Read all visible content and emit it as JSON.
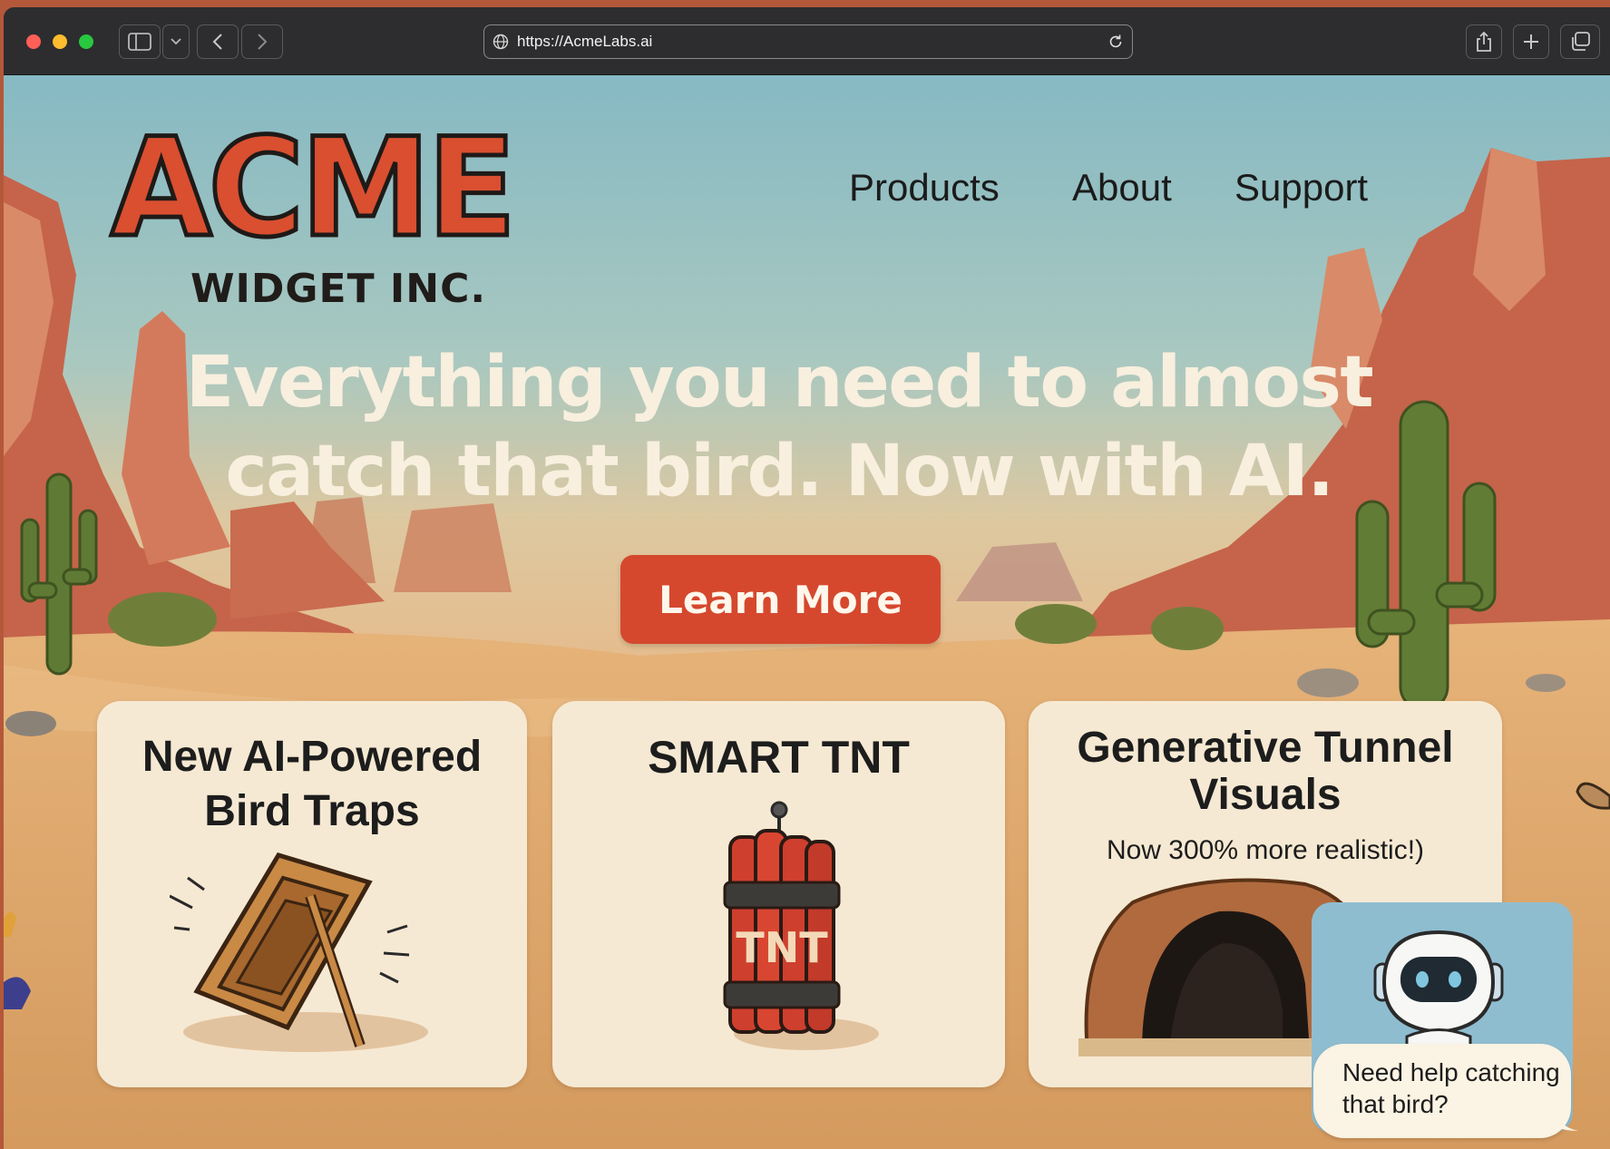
{
  "browser": {
    "url": "https://AcmeLabs.ai"
  },
  "logo": {
    "name": "ACME",
    "subtitle": "WIDGET INC."
  },
  "nav": {
    "products": "Products",
    "about": "About",
    "support": "Support"
  },
  "hero": {
    "headline": "Everything you need to almost catch that bird. Now with AI.",
    "cta_label": "Learn More"
  },
  "cards": [
    {
      "title": "New AI-Powered Bird Traps",
      "art": "wooden-box-trap"
    },
    {
      "title": "SMART TNT",
      "art": "tnt-bundle",
      "label": "TNT"
    },
    {
      "title": "Generative Tunnel Visuals",
      "subtitle": "Now 300% more realistic!)",
      "art": "rock-tunnel"
    }
  ],
  "chat": {
    "message": "Need help catching that bird?",
    "avatar": "robot-icon"
  },
  "colors": {
    "brand_red": "#d94f30",
    "button_red": "#d5482e",
    "card_bg": "#f6e9d3",
    "sky": "#8fbdc6",
    "sand": "#d9a668"
  }
}
